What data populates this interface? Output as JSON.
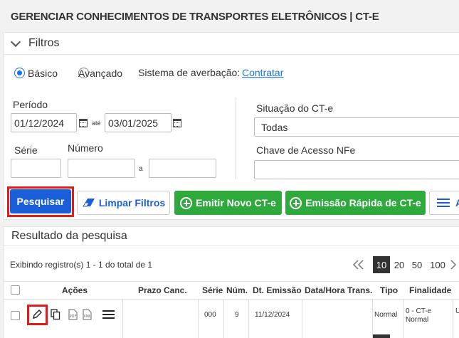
{
  "page": {
    "title": "GERENCIAR CONHECIMENTOS DE TRANSPORTES ELETRÔNICOS | CT-E"
  },
  "filters": {
    "header": "Filtros",
    "mode_basic": "Básico",
    "mode_advanced": "Avançado",
    "selected_mode": "Básico",
    "averbacao_label": "Sistema de averbação:",
    "averbacao_link": "Contratar",
    "periodo_label": "Período",
    "date_from": "01/12/2024",
    "ate_label": "até",
    "date_to": "03/01/2025",
    "serie_label": "Série",
    "numero_label": "Número",
    "a_label": "a",
    "situacao_label": "Situação do CT-e",
    "situacao_value": "Todas",
    "chave_label": "Chave de Acesso NFe"
  },
  "actions": {
    "search": "Pesquisar",
    "clear": "Limpar Filtros",
    "new_cte": "Emitir Novo CT-e",
    "quick_cte": "Emissão Rápida de CT-e",
    "more": "A"
  },
  "results": {
    "header": "Resultado da pesquisa",
    "summary": "Exibindo registro(s) 1 - 1 do total de 1",
    "page_sizes": [
      "10",
      "20",
      "50",
      "100"
    ],
    "selected_page_size": "10",
    "columns": [
      "Ações",
      "Prazo Canc.",
      "Série",
      "Núm.",
      "Dt. Emissão",
      "Data/Hora Trans.",
      "Tipo",
      "Finalidade"
    ],
    "rows": [
      {
        "prazo": "",
        "serie": "000",
        "numero": "9",
        "emissao": "11/12/2024",
        "transmissao": "",
        "tipo": "Normal",
        "finalidade": "0 - CT-e Normal",
        "extra": "U"
      }
    ]
  },
  "colors": {
    "primary": "#1a5ed8",
    "green": "#2eaa3c",
    "highlight": "#e01b1b"
  }
}
